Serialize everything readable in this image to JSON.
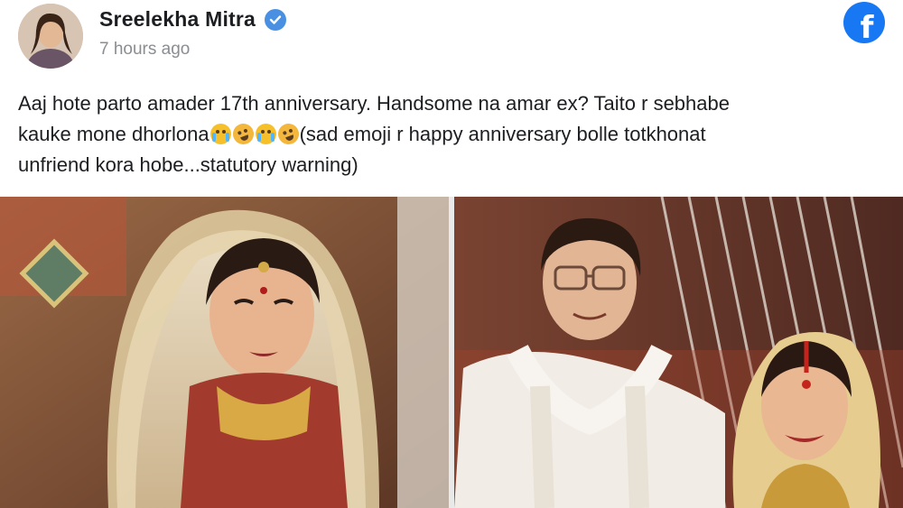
{
  "post": {
    "author": "Sreelekha Mitra",
    "timestamp": "7 hours ago",
    "platform_logo_letter": "f",
    "text_line1": "Aaj hote parto amader 17th anniversary. Handsome na amar ex? Taito r sebhabe",
    "text_line2_a": "kauke mone dhorlona",
    "text_line2_b": "(sad emoji r happy anniversary bolle totkhonat",
    "text_line3": "unfriend kora hobe...statutory warning)",
    "emojis": [
      "crying-face",
      "laughing-face",
      "crying-face",
      "laughing-face"
    ]
  },
  "colors": {
    "facebook_blue": "#1877f2",
    "verified_blue": "#4a90e2",
    "text": "#1c1e21",
    "muted": "#8a8d91"
  }
}
